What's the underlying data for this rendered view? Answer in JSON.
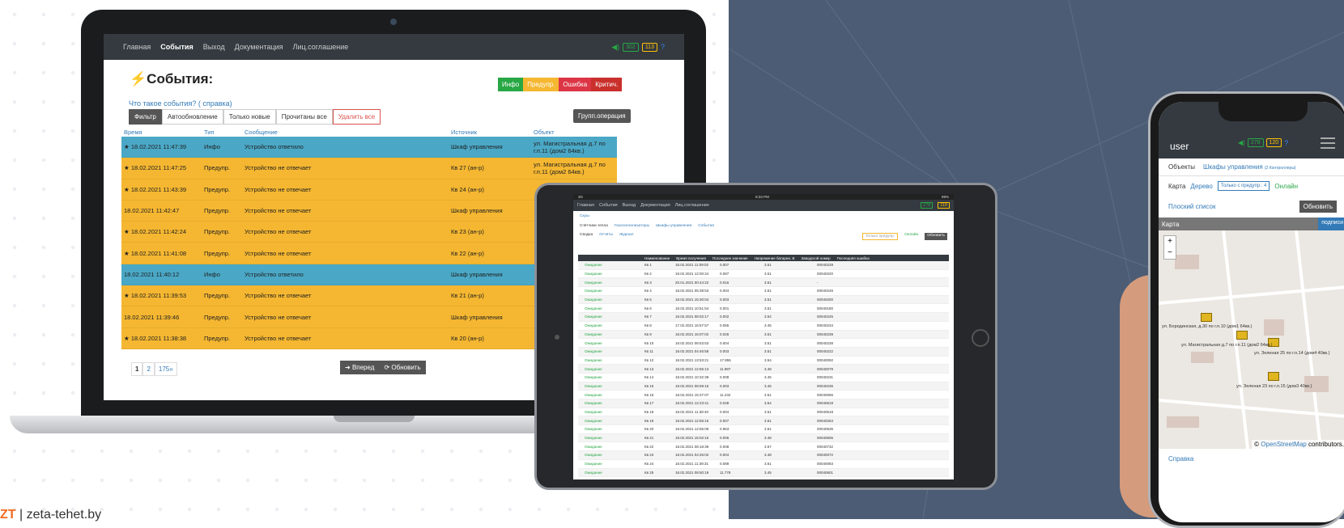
{
  "laptop": {
    "nav": [
      "Главная",
      "События",
      "Выход",
      "Документация",
      "Лиц.соглашение"
    ],
    "status": {
      "ok": "302",
      "warn": "113"
    },
    "title": "События:",
    "legend": [
      "Инфо",
      "Предупр.",
      "Ошибка",
      "Критич."
    ],
    "help": "Что такое события? ( справка)",
    "toolbar": [
      "Фильтр",
      "Автообновление",
      "Только новые",
      "Прочитаны все",
      "Удалить все"
    ],
    "group_op": "Групп.операция",
    "columns": [
      "Время",
      "Тип",
      "Сообщение",
      "Источник",
      "Объект"
    ],
    "rows": [
      {
        "star": "★",
        "time": "18.02.2021 11:47:39",
        "type": "Инфо",
        "msg": "Устройство ответило",
        "src": "Шкаф управления",
        "obj": "ул. Магистральная д.7 по г.п.11 (дом2 64кв.)",
        "cls": "info"
      },
      {
        "star": "★",
        "time": "18.02.2021 11:47:25",
        "type": "Предупр.",
        "msg": "Устройство не отвечает",
        "src": "Кв 27 (ан-р)",
        "obj": "ул. Магистральная д.7 по г.п.11 (дом2 64кв.)",
        "cls": "warn"
      },
      {
        "star": "★",
        "time": "18.02.2021 11:43:39",
        "type": "Предупр.",
        "msg": "Устройство не отвечает",
        "src": "Кв 24 (ан-р)",
        "obj": "",
        "cls": "warn"
      },
      {
        "star": "",
        "time": "18.02.2021 11:42:47",
        "type": "Предупр.",
        "msg": "Устройство не отвечает",
        "src": "Шкаф управления",
        "obj": "",
        "cls": "warn"
      },
      {
        "star": "★",
        "time": "18.02.2021 11:42:24",
        "type": "Предупр.",
        "msg": "Устройство не отвечает",
        "src": "Кв 23 (ан-р)",
        "obj": "",
        "cls": "warn"
      },
      {
        "star": "★",
        "time": "18.02.2021 11:41:08",
        "type": "Предупр.",
        "msg": "Устройство не отвечает",
        "src": "Кв 22 (ан-р)",
        "obj": "",
        "cls": "warn"
      },
      {
        "star": "",
        "time": "18.02.2021 11:40:12",
        "type": "Инфо",
        "msg": "Устройство ответило",
        "src": "Шкаф управления",
        "obj": "",
        "cls": "info"
      },
      {
        "star": "★",
        "time": "18.02.2021 11:39:53",
        "type": "Предупр.",
        "msg": "Устройство не отвечает",
        "src": "Кв 21 (ан-р)",
        "obj": "",
        "cls": "warn"
      },
      {
        "star": "",
        "time": "18.02.2021 11:39:46",
        "type": "Предупр.",
        "msg": "Устройство не отвечает",
        "src": "Шкаф управления",
        "obj": "",
        "cls": "warn"
      },
      {
        "star": "★",
        "time": "18.02.2021 11:38:38",
        "type": "Предупр.",
        "msg": "Устройство не отвечает",
        "src": "Кв 20 (ан-р)",
        "obj": "",
        "cls": "warn"
      }
    ],
    "pages": [
      "1",
      "2",
      "175»"
    ],
    "btn_forward": "Вперед",
    "btn_refresh": "Обновить"
  },
  "tablet": {
    "status_left": "3G",
    "status_center": "8:33 PM",
    "status_right": "99%",
    "nav": [
      "Главная",
      "События",
      "Выход",
      "Документация",
      "Лиц.соглашение"
    ],
    "status": {
      "ok": "278",
      "warn": "119"
    },
    "crumb": "Скуш",
    "tabs": [
      "Счётчики тепла",
      "Газосигнализаторы",
      "Шкафы управления",
      "События"
    ],
    "subtabs": [
      "Сводка",
      "Отчёты",
      "Журнал"
    ],
    "filter": "Только предупр.",
    "online": "Онлайн",
    "refresh": "Обновить",
    "columns": [
      "Наименование",
      "Время получения",
      "Последнее значение",
      "Напряжение батареи, В",
      "Заводской номер",
      "Последняя ошибка"
    ],
    "rows": [
      [
        "Ожидание",
        "Кв 1",
        "18.02.2021 11:09:02",
        "0.007",
        "3.51",
        "00040229"
      ],
      [
        "Ожидание",
        "Кв 2",
        "18.02.2021 12:00:24",
        "0.087",
        "3.51",
        "00040220"
      ],
      [
        "Ожидание",
        "Кв 3",
        "20.01.2021 00:44:22",
        "0.016",
        "3.51",
        "-"
      ],
      [
        "Ожидание",
        "Кв 4",
        "18.02.2021 05:38:53",
        "0.004",
        "3.51",
        "00040246"
      ],
      [
        "Ожидание",
        "Кв 5",
        "18.02.2021 15:30:04",
        "0.003",
        "3.51",
        "00040200"
      ],
      [
        "Ожидание",
        "Кв 6",
        "18.02.2021 10:51:54",
        "0.001",
        "3.51",
        "00040180"
      ],
      [
        "Ожидание",
        "Кв 7",
        "18.02.2021 08:02:17",
        "0.002",
        "3.54",
        "00040225"
      ],
      [
        "Ожидание",
        "Кв 8",
        "17.02.2021 16:57:57",
        "0.055",
        "3.45",
        "00040234"
      ],
      [
        "Ожидание",
        "Кв 9",
        "18.02.2021 15:07:02",
        "0.026",
        "3.51",
        "00040239"
      ],
      [
        "Ожидание",
        "Кв 10",
        "18.02.2021 08:53:53",
        "0.004",
        "3.51",
        "00040238"
      ],
      [
        "Ожидание",
        "Кв 11",
        "18.02.2021 04:46:58",
        "0.003",
        "3.51",
        "00040222"
      ],
      [
        "Ожидание",
        "Кв 12",
        "18.02.2021 13:53:21",
        "17.855",
        "3.54",
        "00040092"
      ],
      [
        "Ожидание",
        "Кв 13",
        "18.02.2021 12:55:13",
        "11.987",
        "3.48",
        "00040079"
      ],
      [
        "Ожидание",
        "Кв 14",
        "18.02.2021 10:32:39",
        "0.008",
        "3.45",
        "00040231"
      ],
      [
        "Ожидание",
        "Кв 15",
        "18.02.2021 08:59:16",
        "0.003",
        "3.45",
        "00040236"
      ],
      [
        "Ожидание",
        "Кв 16",
        "18.02.2021 15:37:07",
        "11.232",
        "3.51",
        "00040066"
      ],
      [
        "Ожидание",
        "Кв 17",
        "18.02.2021 12:23:41",
        "0.048",
        "3.54",
        "00040619"
      ],
      [
        "Ожидание",
        "Кв 18",
        "18.02.2021 11:38:40",
        "0.004",
        "3.51",
        "00040518"
      ],
      [
        "Ожидание",
        "Кв 19",
        "18.02.2021 12:55:15",
        "0.007",
        "3.51",
        "00040263"
      ],
      [
        "Ожидание",
        "Кв 20",
        "18.02.2021 12:55:09",
        "0.963",
        "3.51",
        "00040535"
      ],
      [
        "Ожидание",
        "Кв 21",
        "18.02.2021 15:02:16",
        "0.006",
        "3.48",
        "00040606"
      ],
      [
        "Ожидание",
        "Кв 22",
        "18.02.2021 08:18:39",
        "0.008",
        "3.57",
        "00040732"
      ],
      [
        "Ожидание",
        "Кв 23",
        "18.02.2021 04:26:02",
        "0.004",
        "3.48",
        "00040072"
      ],
      [
        "Ожидание",
        "Кв 24",
        "18.02.2021 11:39:31",
        "0.089",
        "3.51",
        "00040083"
      ],
      [
        "Ожидание",
        "Кв 25",
        "18.02.2021 08:50:19",
        "11.778",
        "3.45",
        "00040601"
      ]
    ]
  },
  "phone": {
    "user": "user",
    "status": {
      "ok": "278",
      "warn": "120"
    },
    "tabs": [
      "Объекты",
      "Шкафы управления"
    ],
    "tab_count": "(2 Контроллеры)",
    "views": [
      "Карта",
      "Дерево"
    ],
    "filter": "Только с предупр.: 4",
    "online": "Онлайн",
    "flat": "Плоский список",
    "refresh": "Обновить",
    "map_title": "Карта",
    "sign": "подписи",
    "labels": [
      "ул. Бородинская, д.30 по г.п.10 (дом1 64кв.)",
      "ул. Магистральная д.7 по г.п.11 (дом2 64кв.)",
      "ул. Зеленая 25 по г.п.14 (дом4 40кв.)",
      "ул. Зеленая 23 по г.п.15 (дом3 40кв.)"
    ],
    "attribution_link": "OpenStreetMap",
    "attribution_rest": " contributors.",
    "help": "Справка"
  },
  "brand": "zeta-tehet.by"
}
